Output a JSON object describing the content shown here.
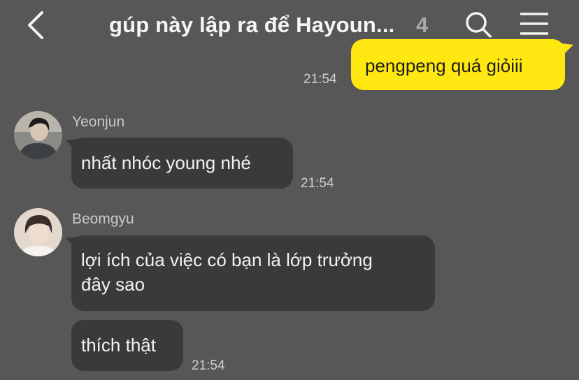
{
  "header": {
    "title": "gúp này lập ra để Hayoun...",
    "member_count": "4",
    "icons": {
      "back": "chevron-left-icon",
      "search": "search-icon",
      "menu": "hamburger-menu-icon"
    }
  },
  "messages": [
    {
      "from": "me",
      "text": "pengpeng quá giỏiii",
      "time": "21:54"
    },
    {
      "from": "Yeonjun",
      "text": "nhất nhóc young nhé",
      "time": "21:54"
    },
    {
      "from": "Beomgyu",
      "lines": [
        "lợi ích của việc có bạn là lớp trưởng",
        "đây sao"
      ]
    },
    {
      "from": "Beomgyu",
      "text": "thích thật",
      "time": "21:54"
    }
  ],
  "colors": {
    "background": "#575757",
    "my_bubble": "#ffe812",
    "other_bubble": "#3a3a3c"
  }
}
